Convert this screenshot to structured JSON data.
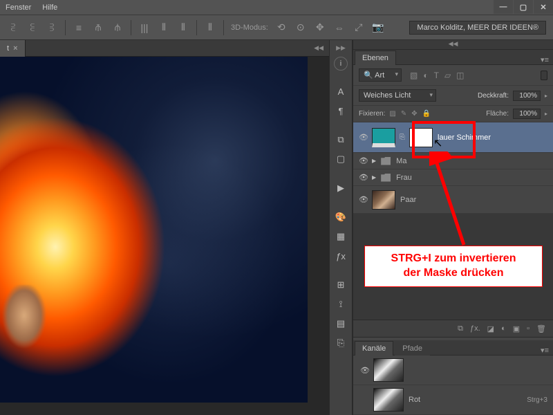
{
  "menu": {
    "fenster": "Fenster",
    "hilfe": "Hilfe"
  },
  "winControls": {
    "min": "—",
    "max": "▢",
    "close": "✕"
  },
  "options": {
    "mode_label": "3D-Modus:",
    "brand": "Marco Kolditz, MEER DER IDEEN®"
  },
  "docTab": {
    "title": "t",
    "close": "×"
  },
  "toolstrip": {
    "info": "i",
    "char": "A",
    "para": "¶",
    "swatch": "⧉",
    "adjust": "▢",
    "play": "▶",
    "color": "🎨",
    "lib": "▦",
    "fx": "ƒx",
    "nav": "⊞",
    "measure": "⟟",
    "notes": "▤",
    "clone": "⎘"
  },
  "layersPanel": {
    "tab": "Ebenen",
    "kind": "Art",
    "blend_mode": "Weiches Licht",
    "opacity_label": "Deckkraft:",
    "opacity_value": "100%",
    "lock_label": "Fixieren:",
    "fill_label": "Fläche:",
    "fill_value": "100%",
    "layers": {
      "l1_name": "lauer Schimmer",
      "l2_name": "Ma",
      "l3_name": "Frau",
      "l4_name": "Paar"
    },
    "footer": {
      "link": "⧉",
      "fx": "ƒx.",
      "mask": "◪",
      "adj": "◐",
      "group": "▣",
      "new": "▫",
      "trash": "🗑"
    }
  },
  "annotation": {
    "line1": "STRG+I zum invertieren",
    "line2": "der Maske drücken"
  },
  "channelsPanel": {
    "tab1": "Kanäle",
    "tab2": "Pfade",
    "rows": {
      "r1_name": "Rot",
      "r1_key": "Strg+3"
    }
  }
}
